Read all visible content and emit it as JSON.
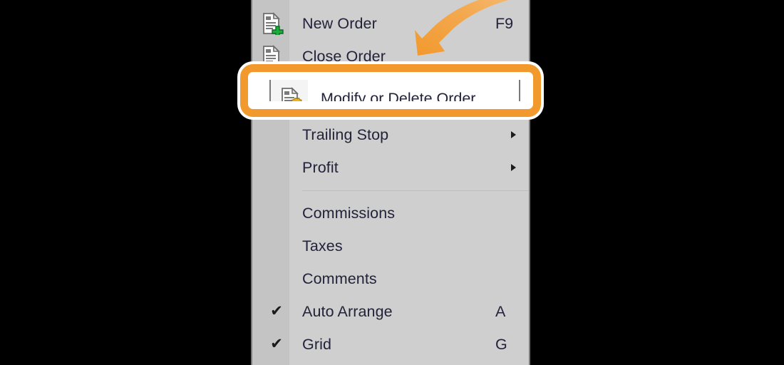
{
  "menu": {
    "name": "chart-context-menu-trading",
    "background_color": "#cfcfcf",
    "gutter_color": "#c4c4c4",
    "border_color": "#7a7a7a",
    "text_color": "#22223a",
    "items": [
      {
        "label": "New Order",
        "shortcut": "F9",
        "icon": "document-add-icon",
        "checked": false,
        "submenu": false
      },
      {
        "label": "Close Order",
        "shortcut": "",
        "icon": "document-close-icon",
        "checked": false,
        "submenu": false
      },
      {
        "label": "Modify or Delete Order",
        "shortcut": "",
        "icon": "document-gear-icon",
        "checked": false,
        "submenu": false
      },
      {
        "label": "Trailing Stop",
        "shortcut": "",
        "icon": "",
        "checked": false,
        "submenu": true
      },
      {
        "label": "Profit",
        "shortcut": "",
        "icon": "",
        "checked": false,
        "submenu": true
      },
      {
        "label": "Commissions",
        "shortcut": "",
        "icon": "",
        "checked": false,
        "submenu": false
      },
      {
        "label": "Taxes",
        "shortcut": "",
        "icon": "",
        "checked": false,
        "submenu": false
      },
      {
        "label": "Comments",
        "shortcut": "",
        "icon": "",
        "checked": false,
        "submenu": false
      },
      {
        "label": "Auto Arrange",
        "shortcut": "A",
        "icon": "",
        "checked": true,
        "submenu": false
      },
      {
        "label": "Grid",
        "shortcut": "G",
        "icon": "",
        "checked": true,
        "submenu": false
      }
    ],
    "checkmark_glyph": "✔"
  },
  "annotation": {
    "highlight_label": "Modify or Delete Order",
    "highlight_icon": "document-gear-icon",
    "highlight_color": "#f2992e",
    "highlight_outline_color": "#ffffff",
    "arrow_color": "#f2a23e",
    "arrow_name": "curved-pointer-arrow"
  }
}
